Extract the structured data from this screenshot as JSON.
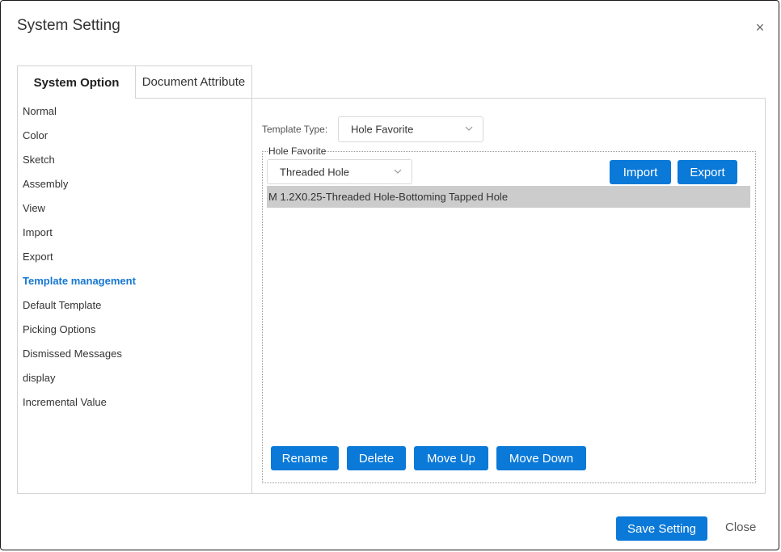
{
  "dialog": {
    "title": "System Setting",
    "close_icon_glyph": "×"
  },
  "tabs": [
    {
      "label": "System Option",
      "active": true
    },
    {
      "label": "Document Attribute",
      "active": false
    }
  ],
  "sidebar": {
    "items": [
      {
        "label": "Normal"
      },
      {
        "label": "Color"
      },
      {
        "label": "Sketch"
      },
      {
        "label": "Assembly"
      },
      {
        "label": "View"
      },
      {
        "label": "Import"
      },
      {
        "label": "Export"
      },
      {
        "label": "Template management",
        "active": true
      },
      {
        "label": "Default Template"
      },
      {
        "label": "Picking Options"
      },
      {
        "label": "Dismissed Messages"
      },
      {
        "label": "display"
      },
      {
        "label": "Incremental Value"
      }
    ]
  },
  "main": {
    "template_type_label": "Template Type:",
    "template_type_value": "Hole Favorite",
    "group_legend": "Hole Favorite",
    "hole_type_value": "Threaded Hole",
    "import_label": "Import",
    "export_label": "Export",
    "list_items": [
      {
        "label": "M 1.2X0.25-Threaded Hole-Bottoming Tapped Hole",
        "selected": true
      }
    ],
    "rename_label": "Rename",
    "delete_label": "Delete",
    "move_up_label": "Move Up",
    "move_down_label": "Move Down"
  },
  "footer": {
    "save_label": "Save Setting",
    "close_label": "Close"
  },
  "colors": {
    "accent": "#0a79d8",
    "active_link": "#1677d2",
    "selected_row": "#cccccc"
  }
}
